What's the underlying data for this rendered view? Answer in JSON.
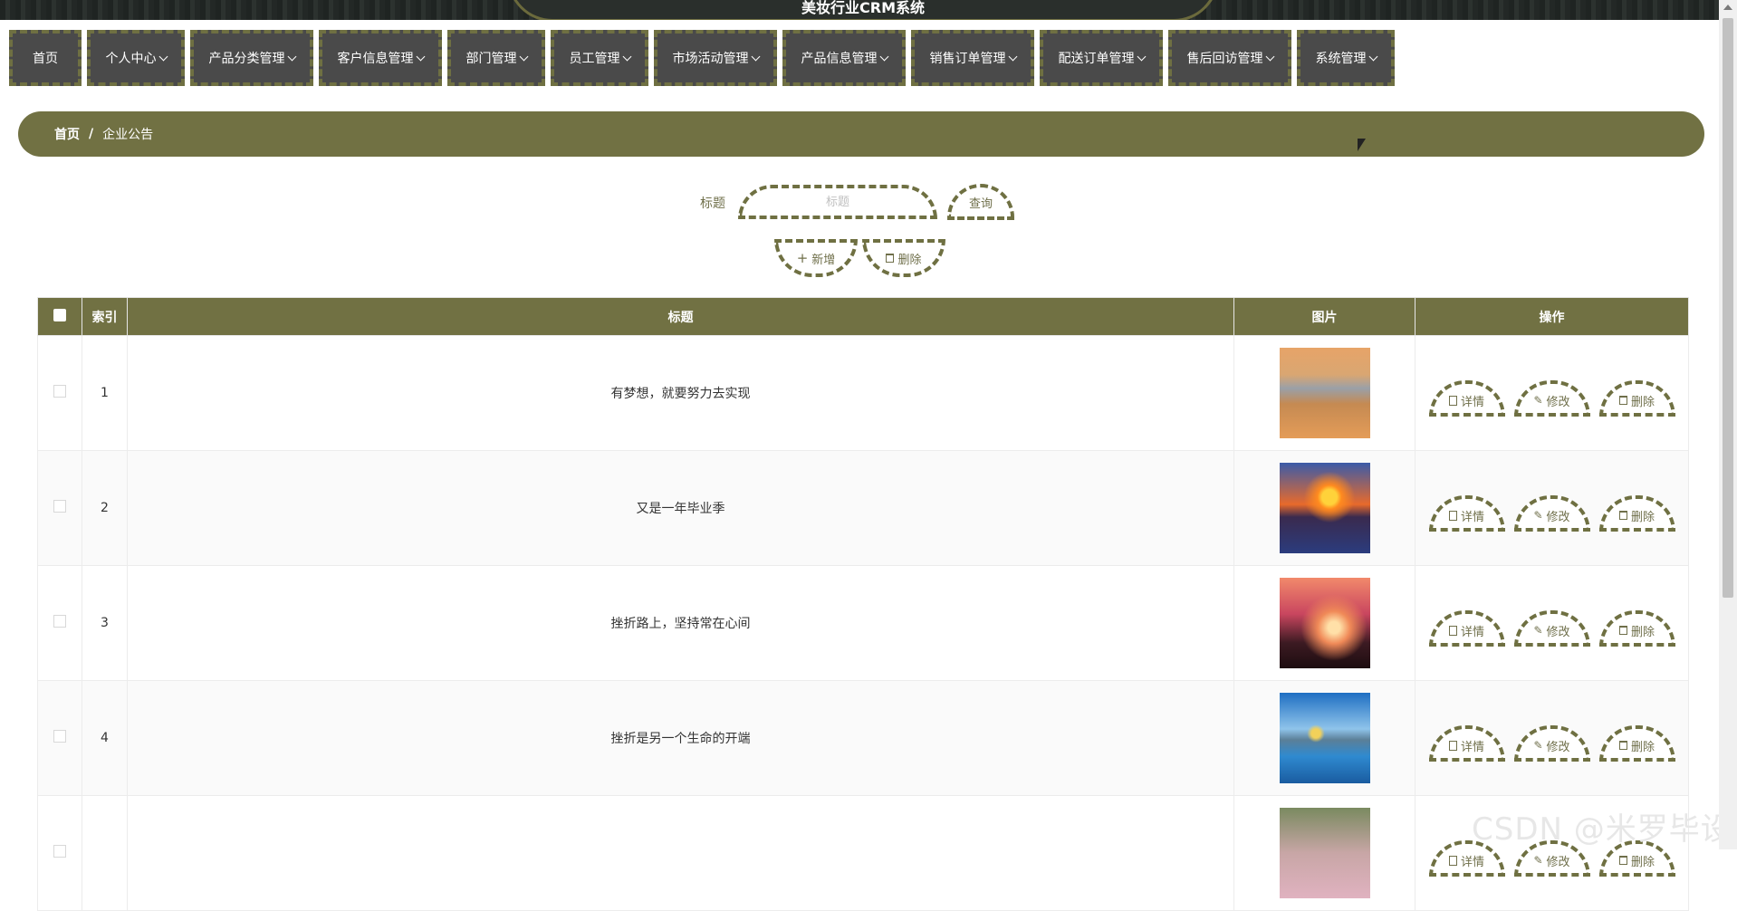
{
  "site": {
    "banner_title": "美妆行业CRM系统"
  },
  "nav": [
    {
      "label": "首页",
      "has_dropdown": false,
      "width": 80
    },
    {
      "label": "个人中心",
      "has_dropdown": true,
      "width": 108
    },
    {
      "label": "产品分类管理",
      "has_dropdown": true,
      "width": 136
    },
    {
      "label": "客户信息管理",
      "has_dropdown": true,
      "width": 136
    },
    {
      "label": "部门管理",
      "has_dropdown": true,
      "width": 108
    },
    {
      "label": "员工管理",
      "has_dropdown": true,
      "width": 108
    },
    {
      "label": "市场活动管理",
      "has_dropdown": true,
      "width": 136
    },
    {
      "label": "产品信息管理",
      "has_dropdown": true,
      "width": 136
    },
    {
      "label": "销售订单管理",
      "has_dropdown": true,
      "width": 136
    },
    {
      "label": "配送订单管理",
      "has_dropdown": true,
      "width": 136
    },
    {
      "label": "售后回访管理",
      "has_dropdown": true,
      "width": 136
    },
    {
      "label": "系统管理",
      "has_dropdown": true,
      "width": 108
    }
  ],
  "breadcrumb": {
    "home": "首页",
    "separator": "/",
    "current": "企业公告"
  },
  "search": {
    "label": "标题",
    "placeholder": "标题",
    "value": "",
    "query_label": "查询"
  },
  "actions": {
    "add_label": "新增",
    "delete_label": "删除"
  },
  "table": {
    "headers": {
      "index": "索引",
      "title": "标题",
      "image": "图片",
      "operations": "操作"
    },
    "rows": [
      {
        "index": "1",
        "title": "有梦想，就要努力去实现",
        "thumb": "thumb-1"
      },
      {
        "index": "2",
        "title": "又是一年毕业季",
        "thumb": "thumb-2"
      },
      {
        "index": "3",
        "title": "挫折路上，坚持常在心间",
        "thumb": "thumb-3"
      },
      {
        "index": "4",
        "title": "挫折是另一个生命的开端",
        "thumb": "thumb-4"
      },
      {
        "index": "",
        "title": "",
        "thumb": "thumb-5"
      }
    ],
    "op_labels": {
      "detail": "详情",
      "edit": "修改",
      "delete": "删除"
    }
  },
  "watermark": "CSDN @米罗毕设",
  "colors": {
    "accent": "#717143",
    "nav_bg": "#4a4a4a",
    "dashed_border": "#6f7042"
  }
}
